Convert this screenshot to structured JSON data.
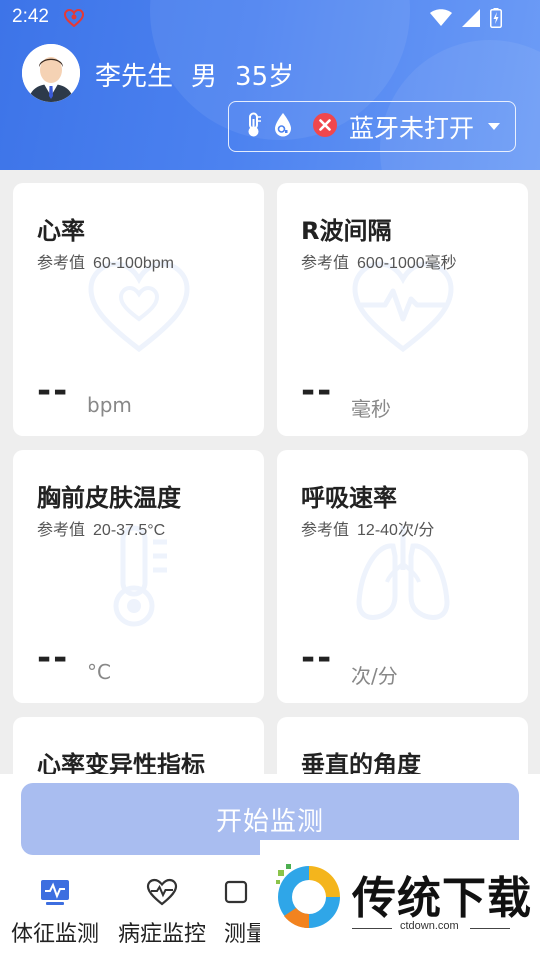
{
  "status_bar": {
    "time": "2:42"
  },
  "profile": {
    "name": "李先生",
    "gender": "男",
    "age": "35岁"
  },
  "bluetooth": {
    "status_text": "蓝牙未打开"
  },
  "cards": [
    {
      "title": "心率",
      "ref_label": "参考值",
      "ref_value": "60-100bpm",
      "value": "--",
      "unit": "bpm"
    },
    {
      "title": "R波间隔",
      "ref_label": "参考值",
      "ref_value": "600-1000毫秒",
      "value": "--",
      "unit": "毫秒"
    },
    {
      "title": "胸前皮肤温度",
      "ref_label": "参考值",
      "ref_value": "20-37.5°C",
      "value": "--",
      "unit": "°C"
    },
    {
      "title": "呼吸速率",
      "ref_label": "参考值",
      "ref_value": "12-40次/分",
      "value": "--",
      "unit": "次/分"
    },
    {
      "title": "心率变异性指标"
    },
    {
      "title": "垂直的角度"
    }
  ],
  "start_button": {
    "label": "开始监测"
  },
  "bottom_nav": [
    {
      "label": "体征监测"
    },
    {
      "label": "病症监控"
    },
    {
      "label": "测量"
    }
  ],
  "watermark": {
    "brand": "传统下载",
    "url": "ctdown.com"
  },
  "colors": {
    "primary": "#4c82f0",
    "start_button": "#a9bdf0",
    "error": "#f0474d"
  }
}
